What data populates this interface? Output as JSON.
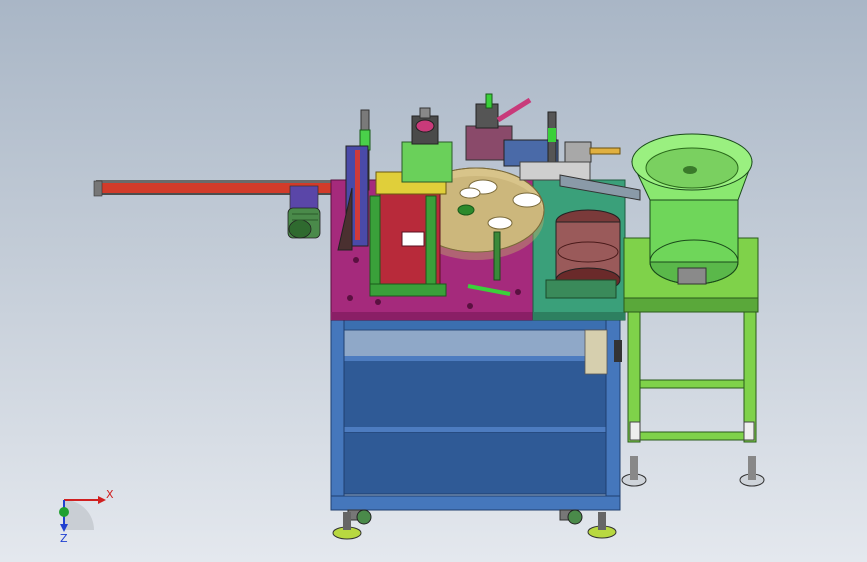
{
  "viewport": {
    "background_top": "#a9b6c6",
    "background_bottom": "#e4e8ee"
  },
  "triad": {
    "x_label": "X",
    "z_label": "Z",
    "x_color": "#d02020",
    "y_color": "#20a030",
    "z_color": "#2040d0"
  },
  "model_colors": {
    "frame": "#3b6fb0",
    "table_top": "#a52a7c",
    "base_plate_right": "#3aa07a",
    "conveyor": "#d23b2a",
    "bowl_feeder": "#6fd65a",
    "stand": "#7fd24a",
    "turntable": "#d8c48a",
    "bracket": "#b82a3a",
    "hopper": "#8a4a4a"
  }
}
